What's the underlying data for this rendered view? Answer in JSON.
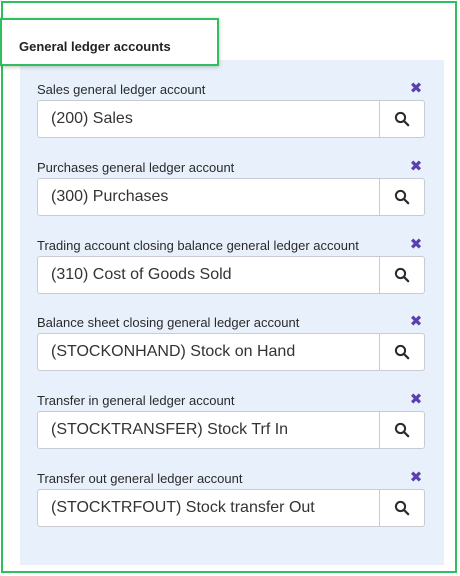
{
  "section": {
    "title": "General ledger accounts"
  },
  "fields": [
    {
      "label": "Sales general ledger account",
      "value": "(200) Sales"
    },
    {
      "label": "Purchases general ledger account",
      "value": "(300) Purchases"
    },
    {
      "label": "Trading account closing balance general ledger account",
      "value": "(310) Cost of Goods Sold"
    },
    {
      "label": "Balance sheet closing general ledger account",
      "value": "(STOCKONHAND) Stock on Hand"
    },
    {
      "label": "Transfer in general ledger account",
      "value": "(STOCKTRANSFER) Stock Trf In"
    },
    {
      "label": "Transfer out general ledger account",
      "value": "(STOCKTRFOUT) Stock transfer Out"
    }
  ],
  "icons": {
    "clear": "✖",
    "search": "search-icon"
  },
  "colors": {
    "highlight_border": "#2fbf5f",
    "panel_background": "#e8f1fb",
    "clear_icon": "#5a3fb0"
  }
}
